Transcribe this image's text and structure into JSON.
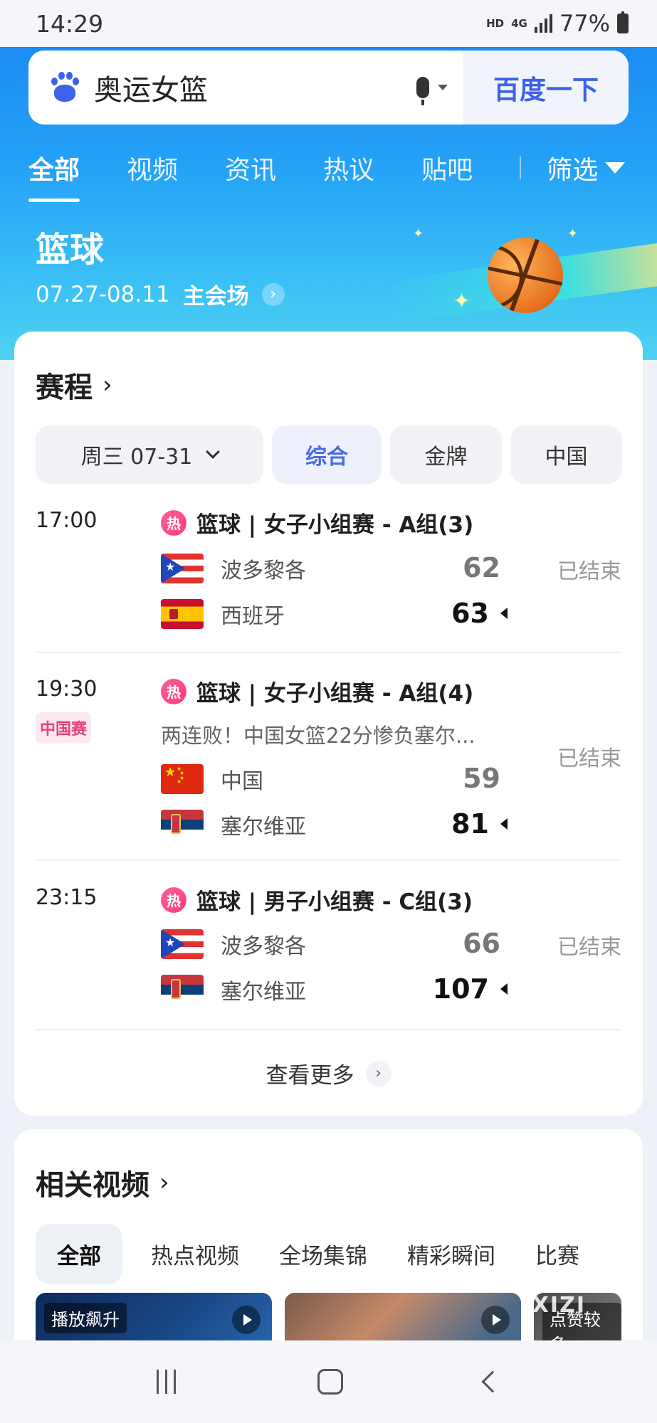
{
  "status_bar": {
    "time": "14:29",
    "network": "HD",
    "net_type": "4G",
    "battery": "77%"
  },
  "search": {
    "query": "奥运女篮",
    "button": "百度一下"
  },
  "tabs": [
    {
      "label": "全部",
      "active": true
    },
    {
      "label": "视频"
    },
    {
      "label": "资讯"
    },
    {
      "label": "热议"
    },
    {
      "label": "贴吧"
    }
  ],
  "filter_label": "筛选",
  "hero": {
    "title": "篮球",
    "dates": "07.27-08.11",
    "venue_link": "主会场"
  },
  "schedule": {
    "title": "赛程",
    "date_filter": "周三 07-31",
    "filters": [
      "综合",
      "金牌",
      "中国"
    ],
    "selected_filter": "综合",
    "hot_label": "热",
    "matches": [
      {
        "time": "17:00",
        "title": "篮球 | 女子小组赛 - A组(3)",
        "team1": {
          "name": "波多黎各",
          "score": "62",
          "flag": "puerto-rico"
        },
        "team2": {
          "name": "西班牙",
          "score": "63",
          "flag": "spain",
          "winner": true
        },
        "status": "已结束"
      },
      {
        "time": "19:30",
        "badge": "中国赛",
        "title": "篮球 | 女子小组赛 - A组(4)",
        "desc": "两连败！中国女篮22分惨负塞尔...",
        "team1": {
          "name": "中国",
          "score": "59",
          "flag": "china"
        },
        "team2": {
          "name": "塞尔维亚",
          "score": "81",
          "flag": "serbia",
          "winner": true
        },
        "status": "已结束"
      },
      {
        "time": "23:15",
        "title": "篮球 | 男子小组赛 - C组(3)",
        "team1": {
          "name": "波多黎各",
          "score": "66",
          "flag": "puerto-rico"
        },
        "team2": {
          "name": "塞尔维亚",
          "score": "107",
          "flag": "serbia",
          "winner": true
        },
        "status": "已结束"
      }
    ],
    "more": "查看更多"
  },
  "videos": {
    "title": "相关视频",
    "tabs": [
      "全部",
      "热点视频",
      "全场集锦",
      "精彩瞬间",
      "比赛"
    ],
    "thumbs": [
      {
        "label": "播放飙升"
      },
      {
        "label": ""
      },
      {
        "label": "点赞较多"
      }
    ],
    "watermark": "XIZI"
  },
  "colors": {
    "accent": "#3b62e8",
    "hot": "#ff3c7a",
    "hero_top": "#1b8cf3",
    "hero_bottom": "#4fd2f0"
  }
}
